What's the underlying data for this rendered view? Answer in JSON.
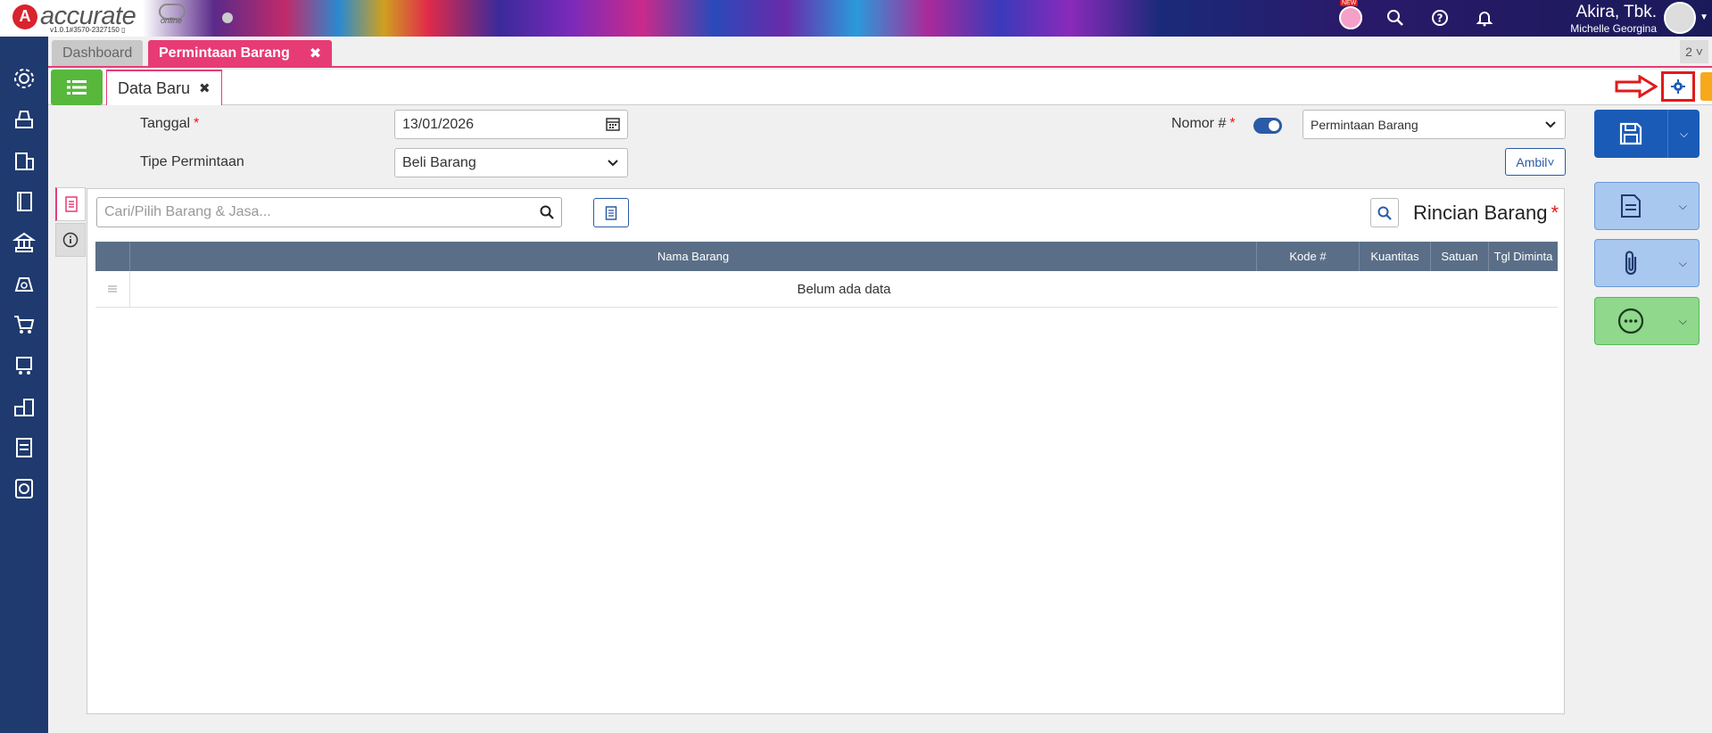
{
  "header": {
    "logo_text": "accurate",
    "logo_sub": "online",
    "version": "v1.0.1#3570-2327150 ▯",
    "new_badge": "NEW",
    "company": "Akira, Tbk.",
    "user_name": "Michelle Georgina"
  },
  "tabs": {
    "dashboard": "Dashboard",
    "active": "Permintaan Barang",
    "count": "2"
  },
  "subtab": {
    "label": "Data Baru"
  },
  "form": {
    "tanggal_label": "Tanggal",
    "tanggal_value": "13/01/2026",
    "tipe_label": "Tipe Permintaan",
    "tipe_value": "Beli Barang",
    "nomor_label": "Nomor #",
    "nomor_value": "Permintaan Barang",
    "ambil_label": "Ambil",
    "required_mark": "*"
  },
  "detail": {
    "search_placeholder": "Cari/Pilih Barang & Jasa...",
    "title": "Rincian Barang",
    "columns": [
      "Nama Barang",
      "Kode #",
      "Kuantitas",
      "Satuan",
      "Tgl Diminta"
    ],
    "empty_text": "Belum ada data"
  },
  "colors": {
    "accent": "#e73b76",
    "sidebar": "#1f3a6e",
    "primary": "#1a5bb8",
    "header_table": "#5a6f87",
    "highlight": "#e11a1a"
  }
}
